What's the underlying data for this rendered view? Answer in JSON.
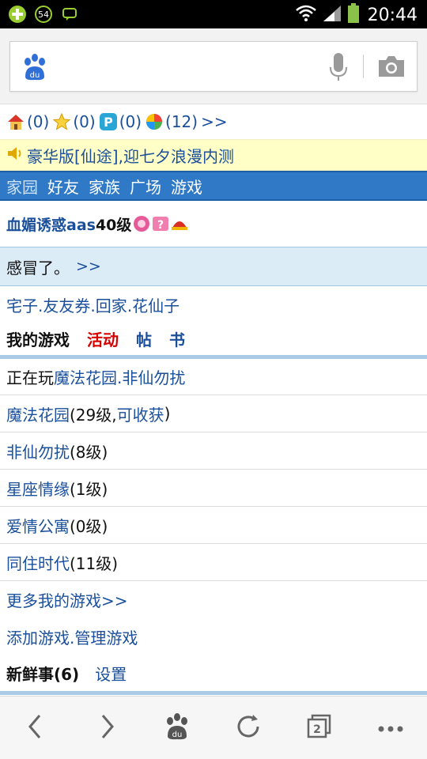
{
  "status_bar": {
    "time": "20:44",
    "badge": "54"
  },
  "search": {
    "placeholder": ""
  },
  "counters": [
    {
      "icon": "house-icon",
      "value": "(0)"
    },
    {
      "icon": "star-icon",
      "value": "(0)"
    },
    {
      "icon": "p-icon",
      "value": "(0)"
    },
    {
      "icon": "ball-icon",
      "value": "(12)"
    }
  ],
  "counters_more": ">>",
  "notice": {
    "text": "豪华版[仙途],迎七夕浪漫内测"
  },
  "nav": [
    "家园",
    "好友",
    "家族",
    "广场",
    "游戏"
  ],
  "user": {
    "name": "血媚诱惑aas",
    "level": "40级"
  },
  "mood": {
    "text": "感冒了。",
    "more": ">>"
  },
  "quick_links": "宅子.友友券.回家.花仙子",
  "tabs": {
    "my_games": "我的游戏",
    "activity": "活动",
    "post": "帖",
    "book": "书"
  },
  "playing": {
    "prefix": "正在玩",
    "games": "魔法花园.非仙勿扰"
  },
  "games": [
    {
      "name": "魔法花园",
      "level_prefix": "(29级,",
      "action": "可收获",
      "suffix": ")"
    },
    {
      "name": "非仙勿扰",
      "level": "(8级)"
    },
    {
      "name": "星座情缘",
      "level": "(1级)"
    },
    {
      "name": "爱情公寓",
      "level": "(0级)"
    },
    {
      "name": "同住时代",
      "level": "(11级)"
    }
  ],
  "more_games": "更多我的游戏>>",
  "manage": "添加游戏.管理游戏",
  "news": {
    "title": "新鲜事(6)",
    "settings": "设置"
  }
}
